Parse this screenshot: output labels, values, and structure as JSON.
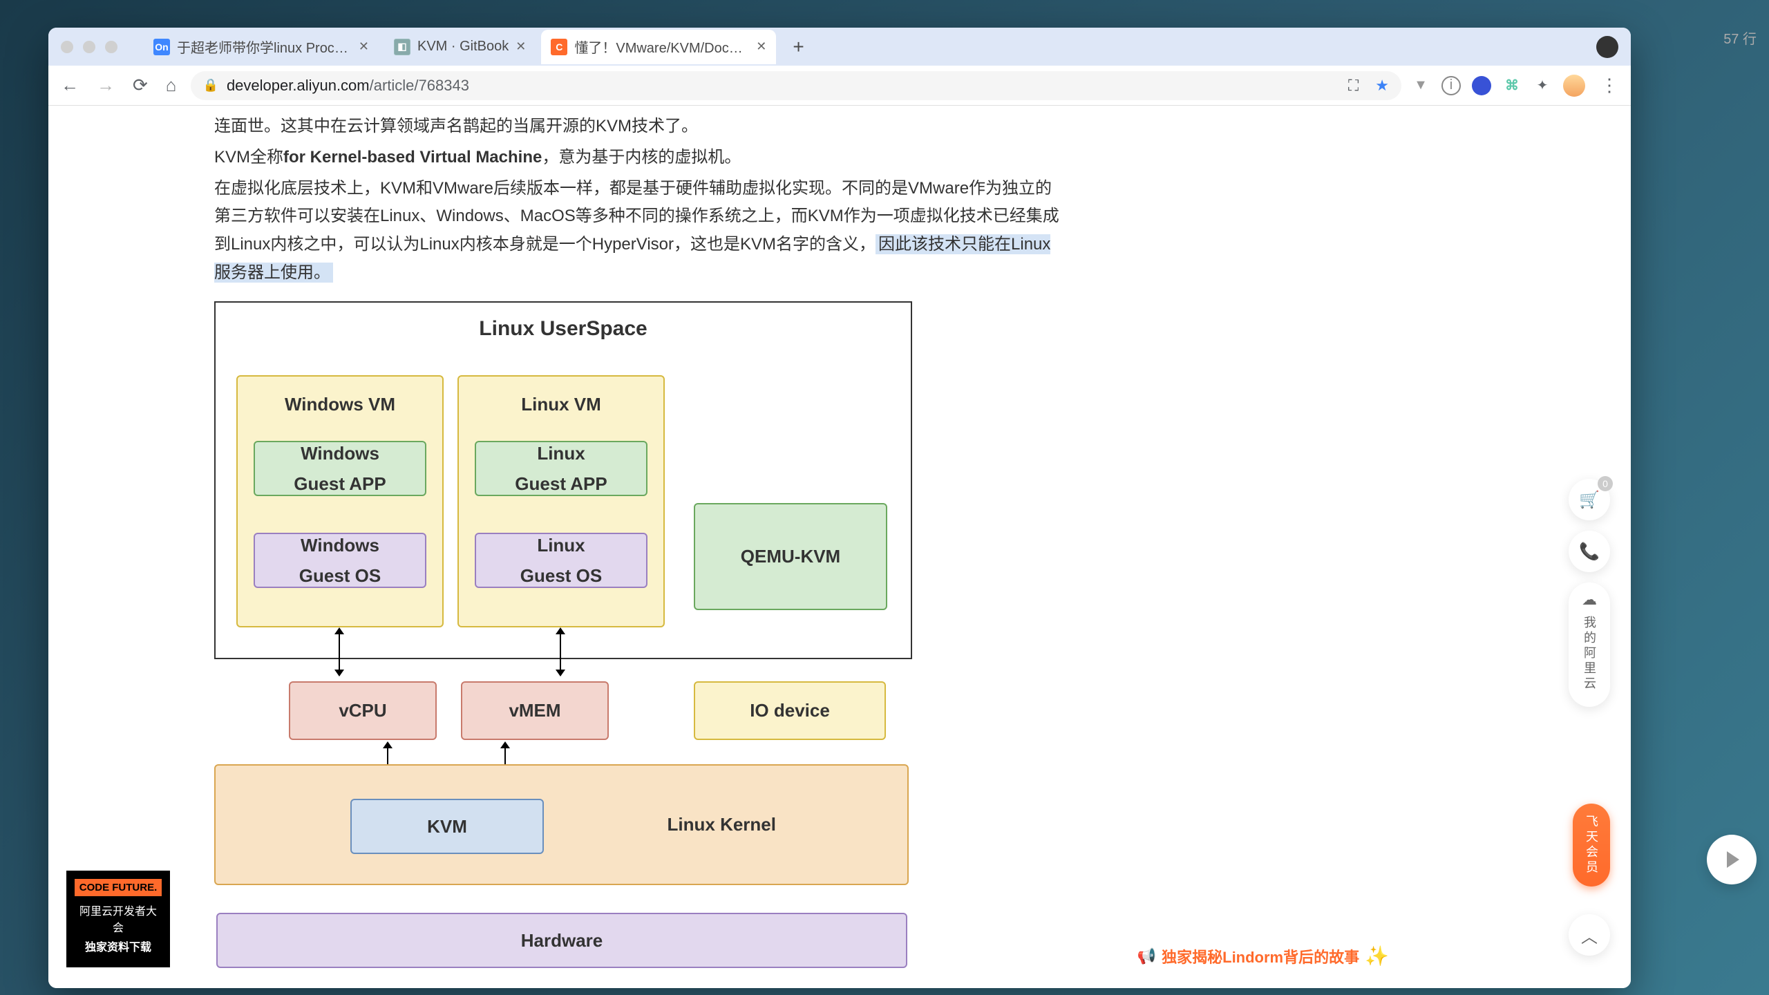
{
  "rightPanel": {
    "lineCount": "57 行"
  },
  "tabs": [
    {
      "title": "于超老师带你学linux ProcessOn",
      "favClass": "fav-blue",
      "favText": "On",
      "active": false
    },
    {
      "title": "KVM · GitBook",
      "favClass": "fav-gray",
      "favText": "",
      "active": false
    },
    {
      "title": "懂了！VMware/KVM/Docker原…",
      "favClass": "fav-orange",
      "favText": "C-)",
      "active": true
    }
  ],
  "url": {
    "host": "developer.aliyun.com",
    "path": "/article/768343"
  },
  "article": {
    "line1": "连面世。这其中在云计算领域声名鹊起的当属开源的KVM技术了。",
    "line2a": "KVM全称",
    "line2b": "for Kernel-based Virtual Machine",
    "line2c": "，意为基于内核的虚拟机。",
    "line3": "在虚拟化底层技术上，KVM和VMware后续版本一样，都是基于硬件辅助虚拟化实现。不同的是VMware作为独立的第三方软件可以安装在Linux、Windows、MacOS等多种不同的操作系统之上，而KVM作为一项虚拟化技术已经集成到Linux内核之中，可以认为Linux内核本身就是一个HyperVisor，这也是KVM名字的含义，",
    "line3_hl": "因此该技术只能在Linux服务器上使用。"
  },
  "diagram": {
    "userspace": "Linux UserSpace",
    "winvm": "Windows VM",
    "linvm": "Linux VM",
    "winapp": "Windows\nGuest APP",
    "linapp": "Linux\nGuest APP",
    "winos": "Windows\nGuest OS",
    "linos": "Linux\nGuest OS",
    "qemu": "QEMU-KVM",
    "vcpu": "vCPU",
    "vmem": "vMEM",
    "io": "IO device",
    "kvm": "KVM",
    "kernel": "Linux Kernel",
    "hardware": "Hardware"
  },
  "widgets": {
    "cartCount": "0",
    "myAliyun": "我的阿里云",
    "member": "飞天会员",
    "lindorm": "独家揭秘Lindorm背后的故事",
    "codeFuture": "CODE FUTURE.",
    "codeFutureSub1": "阿里云开发者大会",
    "codeFutureSub2": "独家资料下载"
  }
}
